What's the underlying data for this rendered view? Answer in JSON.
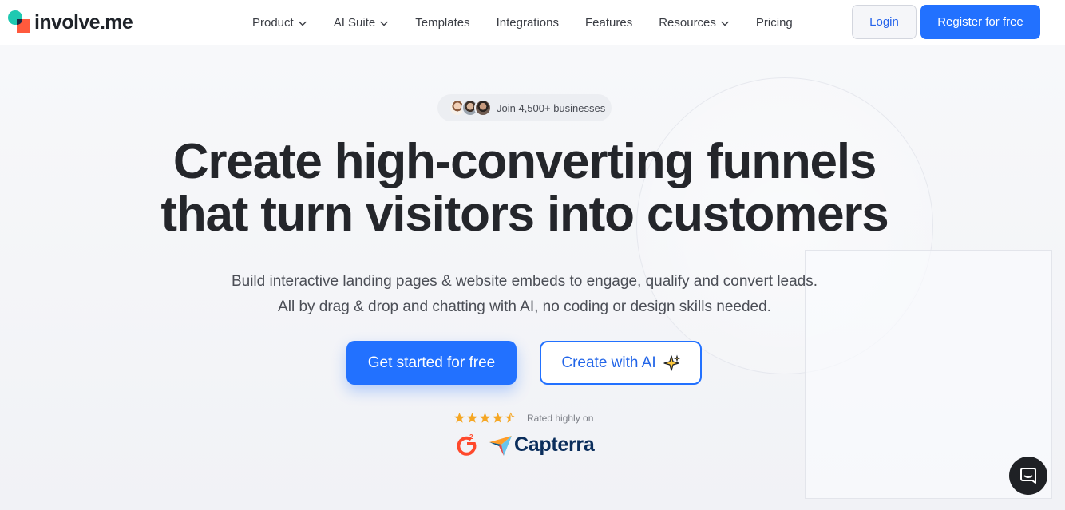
{
  "brand": {
    "name": "involve.me"
  },
  "nav": {
    "items": [
      {
        "label": "Product",
        "dropdown": true
      },
      {
        "label": "AI Suite",
        "dropdown": true
      },
      {
        "label": "Templates",
        "dropdown": false
      },
      {
        "label": "Integrations",
        "dropdown": false
      },
      {
        "label": "Features",
        "dropdown": false
      },
      {
        "label": "Resources",
        "dropdown": true
      },
      {
        "label": "Pricing",
        "dropdown": false
      }
    ],
    "login_label": "Login",
    "register_label": "Register for free"
  },
  "hero": {
    "social_proof": "Join 4,500+ businesses",
    "headline_line1": "Create high-converting funnels",
    "headline_line2": "that turn visitors into customers",
    "subline_line1": "Build interactive landing pages & website embeds to engage, qualify and convert leads.",
    "subline_line2": "All by drag & drop and chatting with AI, no coding or design skills needed.",
    "cta_primary": "Get started for free",
    "cta_secondary": "Create with AI",
    "rating_stars": 4.5,
    "rated_text": "Rated highly on",
    "review_sites": {
      "g2": "G2",
      "capterra": "Capterra"
    }
  },
  "colors": {
    "accent": "#2271ff",
    "star": "#f5a623",
    "g2": "#ff492c",
    "capterra_blue": "#0b2e5c"
  },
  "icons": {
    "nav_dropdown": "chevron-down-icon",
    "ai": "sparkle-icon",
    "chat": "chat-bubble-icon"
  }
}
